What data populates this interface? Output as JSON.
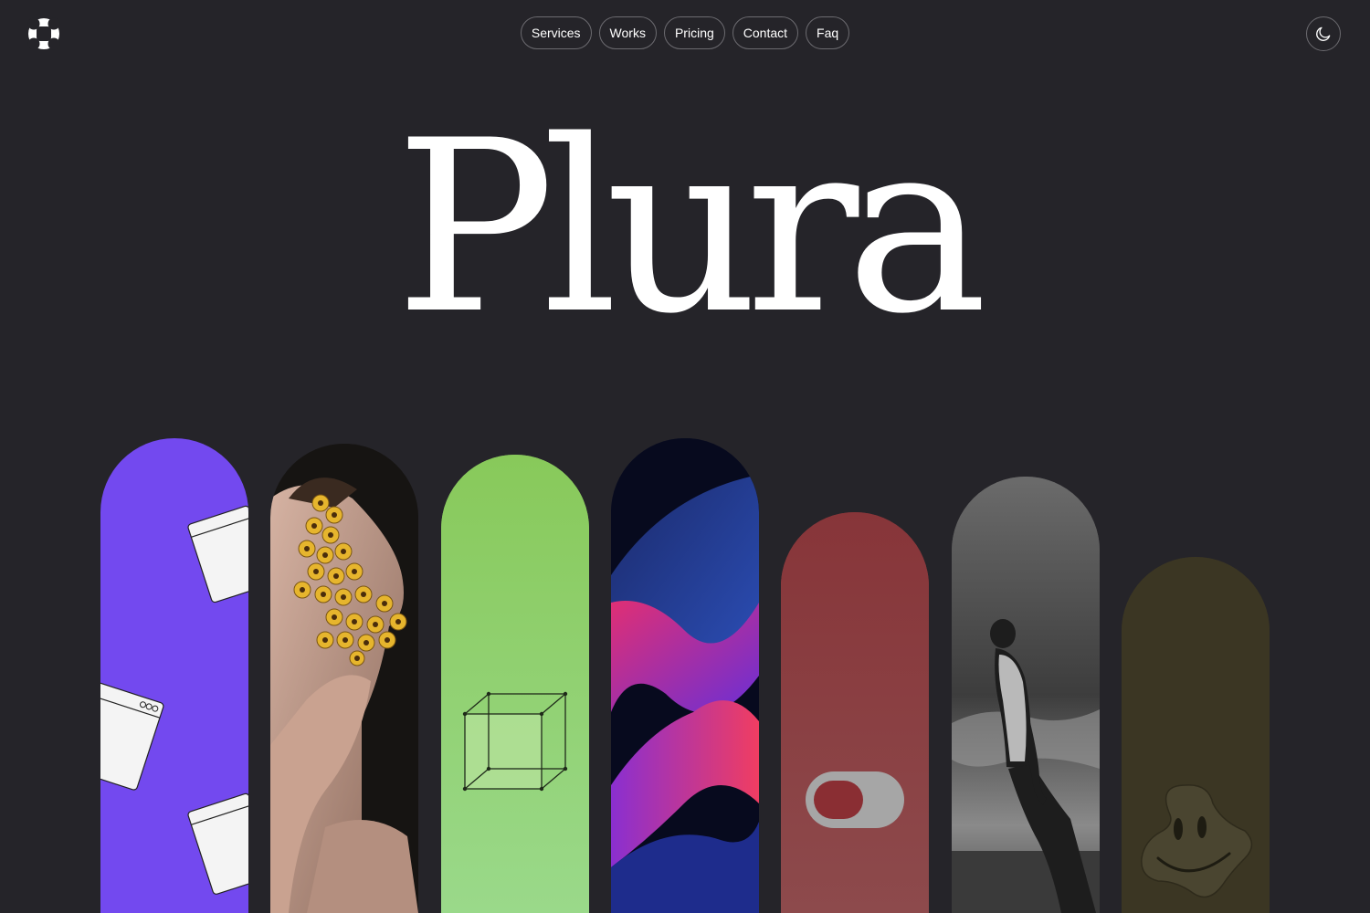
{
  "header": {
    "logo_icon": "plura-logo-icon",
    "nav": [
      {
        "label": "Services"
      },
      {
        "label": "Works"
      },
      {
        "label": "Pricing"
      },
      {
        "label": "Contact"
      },
      {
        "label": "Faq"
      }
    ],
    "theme_toggle_icon": "moon-icon"
  },
  "hero": {
    "title": "Plura"
  },
  "cards": [
    {
      "name": "browser-windows",
      "color": "#7349ef"
    },
    {
      "name": "sunflower-portrait",
      "color": "#1c1a18"
    },
    {
      "name": "wireframe-cube",
      "color": "#8dd067"
    },
    {
      "name": "abstract-waves",
      "color": "#0b0f2a"
    },
    {
      "name": "toggle-switch",
      "color": "#8a3b3c"
    },
    {
      "name": "man-sky-bw",
      "color": "#5b5b5b"
    },
    {
      "name": "smiley-blob",
      "color": "#3c3724"
    }
  ],
  "colors": {
    "background": "#252429",
    "text": "#ffffff",
    "nav_border": "#6c6b70"
  }
}
